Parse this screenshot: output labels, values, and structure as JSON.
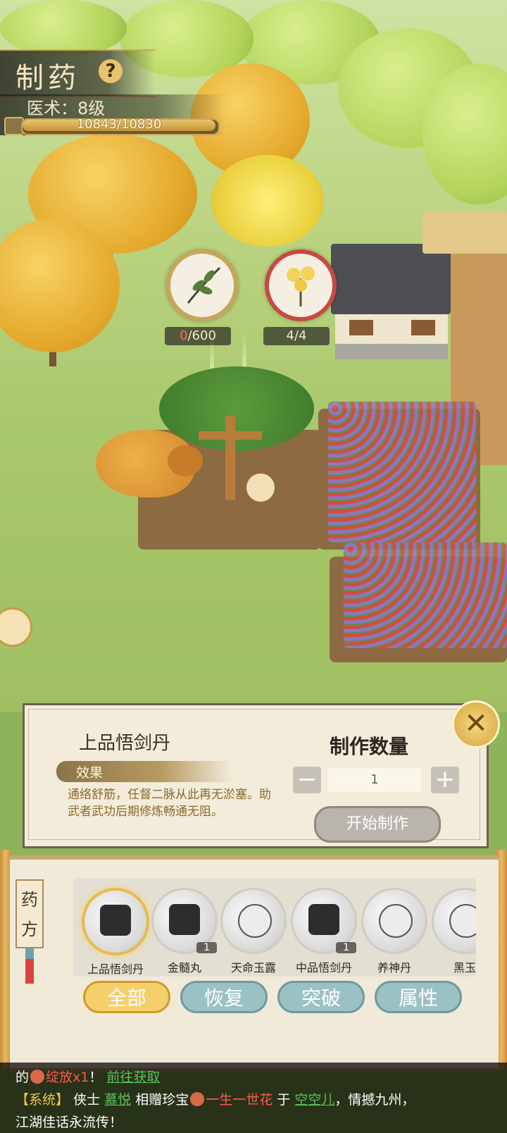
{
  "header": {
    "title": "制药",
    "help_icon": "question-icon",
    "skill_level": "医术：8级",
    "exp_text": "10843/10830",
    "exp_progress": 1.0
  },
  "ingredients": [
    {
      "icon": "herb-leaf-icon",
      "count_current": "0",
      "count_rest": "/600"
    },
    {
      "icon": "yellow-flower-icon",
      "count_text": "4/4"
    }
  ],
  "craft": {
    "item_name": "上品悟剑丹",
    "effect_title": "效果",
    "effect_desc": "通络舒筋，任督二脉从此再无淤塞。助武者武功后期修炼畅通无阻。",
    "qty_title": "制作数量",
    "qty_value": "1",
    "minus_label": "−",
    "plus_label": "+",
    "start_label": "开始制作",
    "close_icon": "close-icon"
  },
  "recipes": {
    "tab_label": "药方",
    "items": [
      {
        "name": "上品悟剑丹",
        "count": "",
        "selected": true
      },
      {
        "name": "金髓丸",
        "count": "1",
        "selected": false
      },
      {
        "name": "天命玉露",
        "count": "",
        "selected": false
      },
      {
        "name": "中品悟剑丹",
        "count": "1",
        "selected": false
      },
      {
        "name": "养神丹",
        "count": "",
        "selected": false
      },
      {
        "name": "黑玉",
        "count": "",
        "selected": false
      }
    ],
    "filters": [
      {
        "label": "全部",
        "active": true
      },
      {
        "label": "恢复",
        "active": false
      },
      {
        "label": "突破",
        "active": false
      },
      {
        "label": "属性",
        "active": false
      }
    ]
  },
  "chat": {
    "line1_prefix": "的",
    "line1_item": "绽放x1",
    "line1_mid": "！",
    "line1_link": "前往获取",
    "line2_tag": "【系统】",
    "line2_a": "侠士",
    "line2_user1": "慕悦",
    "line2_b": "相赠珍宝",
    "line2_item": "一生一世花",
    "line2_c": "于",
    "line2_user2": "空空儿",
    "line2_d": "，情撼九州，",
    "line3": "江湖佳话永流传！"
  }
}
